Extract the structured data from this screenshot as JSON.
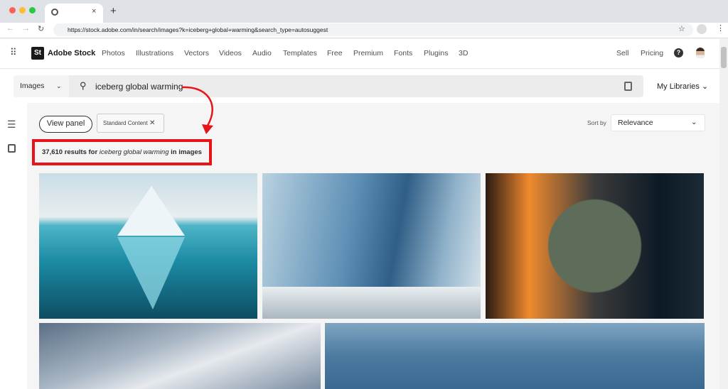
{
  "browser": {
    "url": "https://stock.adobe.com/in/search/images?k=iceberg+global+warming&search_type=autosuggest",
    "tab_close": "×",
    "new_tab": "+"
  },
  "nav": {
    "logo": "St",
    "brand": "Adobe Stock",
    "items": [
      "Photos",
      "Illustrations",
      "Vectors",
      "Videos",
      "Audio",
      "Templates",
      "Free",
      "Premium",
      "Fonts",
      "Plugins",
      "3D"
    ],
    "sell": "Sell",
    "pricing": "Pricing"
  },
  "search": {
    "type": "Images",
    "query": "iceberg global warming",
    "my_libraries": "My Libraries"
  },
  "filters": {
    "view_panel": "View panel",
    "chip": "Standard Content"
  },
  "results": {
    "count": "37,610 results for",
    "query": "iceberg global warming",
    "suffix": "in images"
  },
  "sort": {
    "label": "Sort by",
    "value": "Relevance"
  },
  "colors": {
    "annotation": "#e8141a"
  }
}
